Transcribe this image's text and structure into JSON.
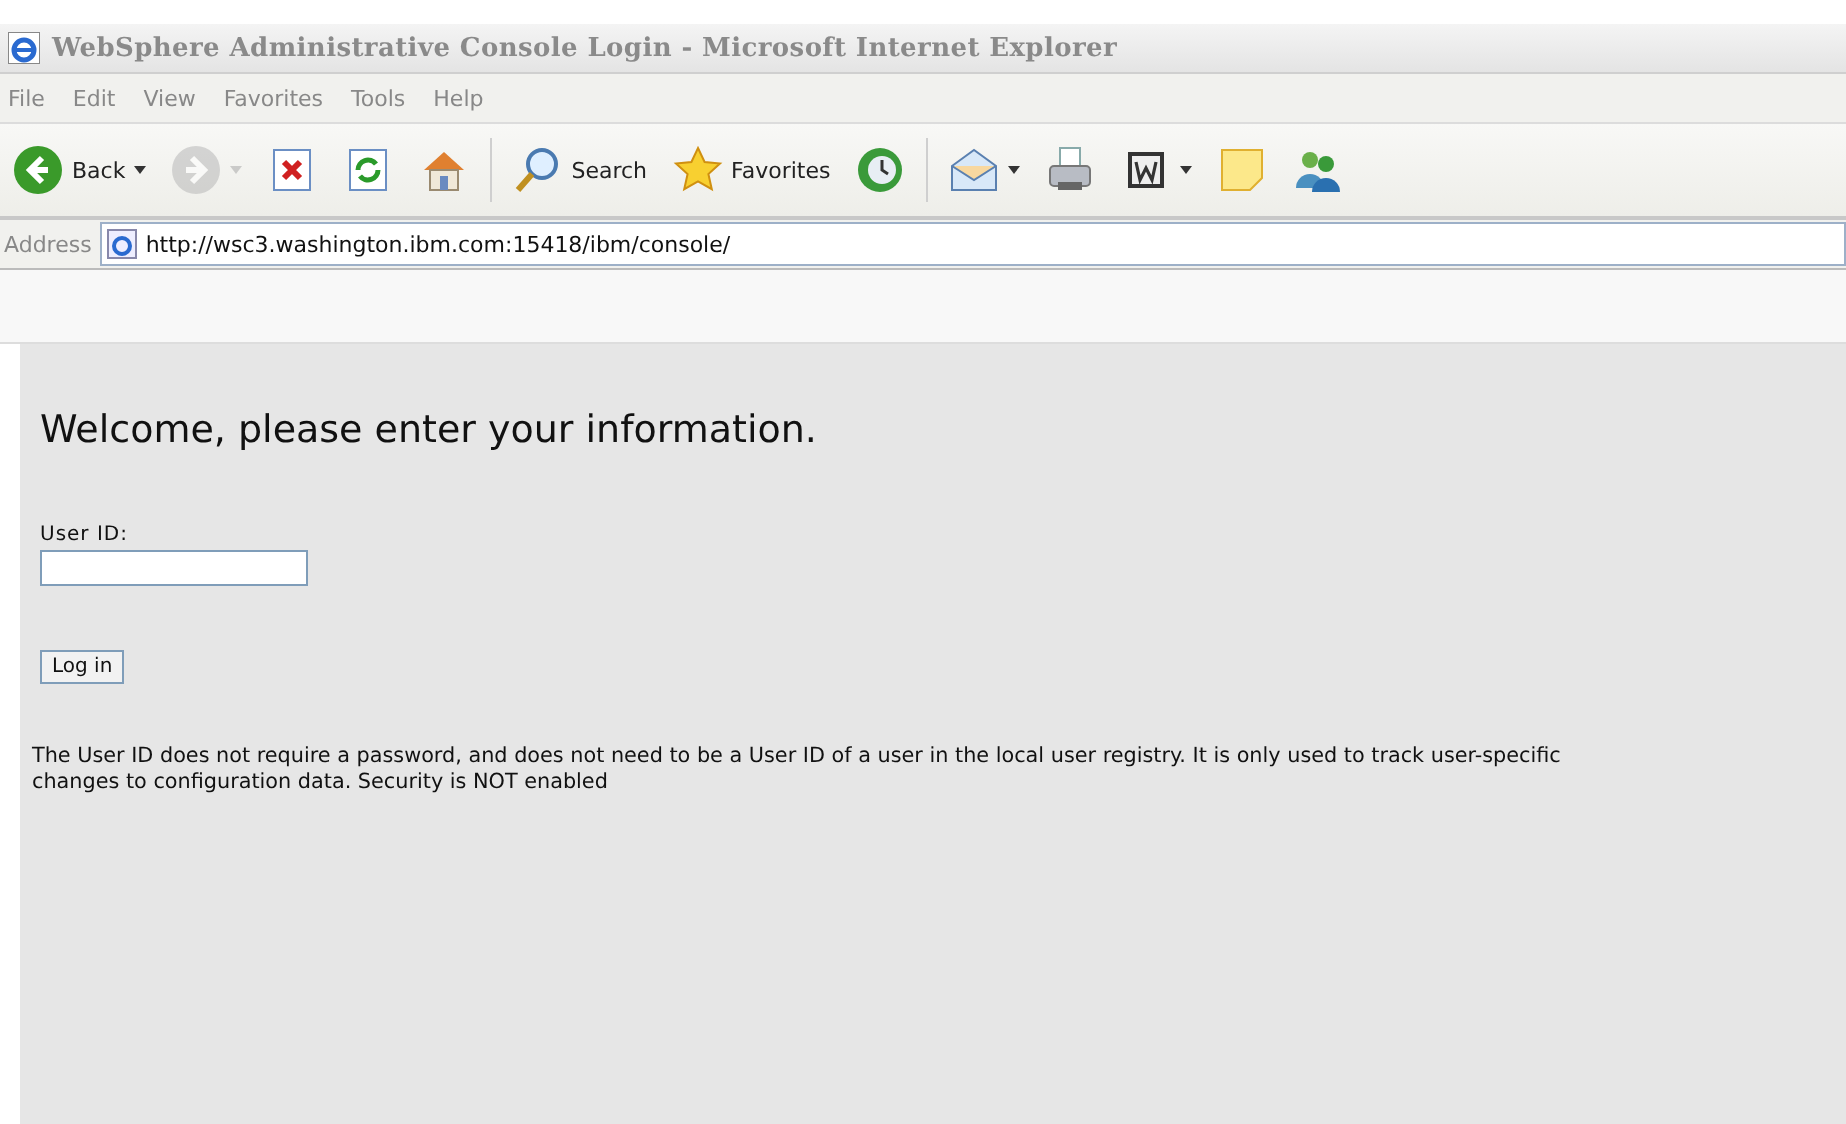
{
  "window": {
    "title": "WebSphere Administrative Console Login - Microsoft Internet Explorer"
  },
  "menu": [
    {
      "label": "File"
    },
    {
      "label": "Edit"
    },
    {
      "label": "View"
    },
    {
      "label": "Favorites"
    },
    {
      "label": "Tools"
    },
    {
      "label": "Help"
    }
  ],
  "toolbar": [
    {
      "kind": "back",
      "label": "Back",
      "dropdown": true,
      "disabled": false
    },
    {
      "kind": "forward",
      "dropdown": true,
      "disabled": true
    },
    {
      "kind": "stop",
      "dropdown": false,
      "disabled": false
    },
    {
      "kind": "refresh",
      "dropdown": false,
      "disabled": false
    },
    {
      "kind": "home",
      "dropdown": false,
      "disabled": false
    },
    {
      "kind": "separator"
    },
    {
      "kind": "search",
      "label": "Search",
      "dropdown": false,
      "disabled": false
    },
    {
      "kind": "favorites",
      "label": "Favorites",
      "dropdown": false,
      "disabled": false
    },
    {
      "kind": "history",
      "dropdown": false,
      "disabled": false
    },
    {
      "kind": "separator"
    },
    {
      "kind": "mail",
      "dropdown": true,
      "disabled": false
    },
    {
      "kind": "print",
      "dropdown": false,
      "disabled": false
    },
    {
      "kind": "word",
      "dropdown": true,
      "disabled": false
    },
    {
      "kind": "note",
      "dropdown": false,
      "disabled": false
    },
    {
      "kind": "messenger",
      "dropdown": false,
      "disabled": false
    }
  ],
  "address": {
    "label": "Address",
    "value": "http://wsc3.washington.ibm.com:15418/ibm/console/"
  },
  "page": {
    "heading": "Welcome, please enter your information.",
    "user_id": {
      "label": "User ID:"
    },
    "login_button": "Log in",
    "note": "The User ID does not require a password, and does not need to be a User ID of a user in the local user registry. It is only used to track user-specific changes to configuration data. Security is NOT enabled"
  }
}
